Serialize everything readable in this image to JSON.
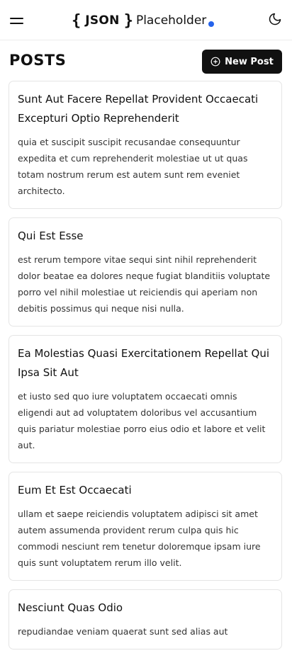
{
  "header": {
    "logo_brace_open": "{",
    "logo_brace_close": "}",
    "logo_json": "JSON",
    "logo_word": "Placeholder",
    "logo_dot_color": "#2563eb",
    "menu_icon": "hamburger-menu-icon",
    "theme_icon": "moon-icon"
  },
  "page": {
    "title": "POSTS",
    "new_post_label": "New Post",
    "new_post_icon": "plus-circle-icon",
    "button_color": "#111111"
  },
  "posts": [
    {
      "title": "Sunt Aut Facere Repellat Provident Occaecati Excepturi Optio Reprehenderit",
      "body": "quia et suscipit suscipit recusandae consequuntur expedita et cum reprehenderit molestiae ut ut quas totam nostrum rerum est autem sunt rem eveniet architecto."
    },
    {
      "title": "Qui Est Esse",
      "body": "est rerum tempore vitae sequi sint nihil reprehenderit dolor beatae ea dolores neque fugiat blanditiis voluptate porro vel nihil molestiae ut reiciendis qui aperiam non debitis possimus qui neque nisi nulla."
    },
    {
      "title": "Ea Molestias Quasi Exercitationem Repellat Qui Ipsa Sit Aut",
      "body": "et iusto sed quo iure voluptatem occaecati omnis eligendi aut ad voluptatem doloribus vel accusantium quis pariatur molestiae porro eius odio et labore et velit aut."
    },
    {
      "title": "Eum Et Est Occaecati",
      "body": "ullam et saepe reiciendis voluptatem adipisci sit amet autem assumenda provident rerum culpa quis hic commodi nesciunt rem tenetur doloremque ipsam iure quis sunt voluptatem rerum illo velit."
    },
    {
      "title": "Nesciunt Quas Odio",
      "body": "repudiandae veniam quaerat sunt sed alias aut"
    }
  ]
}
